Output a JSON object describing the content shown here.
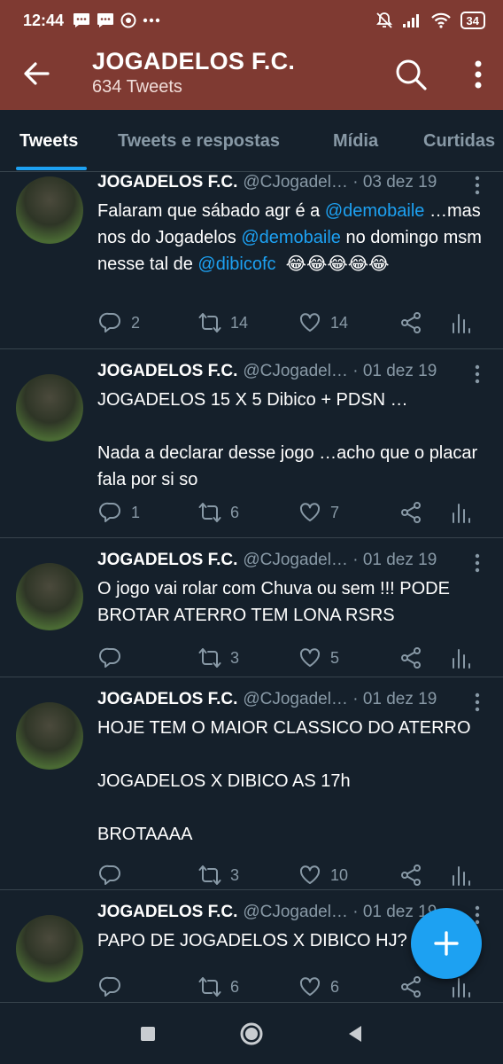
{
  "status_bar": {
    "time": "12:44",
    "battery": "34"
  },
  "header": {
    "title": "JOGADELOS F.C.",
    "subtitle": "634 Tweets"
  },
  "tabs": [
    {
      "label": "Tweets",
      "active": true
    },
    {
      "label": "Tweets e respostas",
      "active": false
    },
    {
      "label": "Mídia",
      "active": false
    },
    {
      "label": "Curtidas",
      "active": false
    }
  ],
  "tweets": [
    {
      "name": "JOGADELOS F.C.",
      "handle": "@CJogadel…",
      "date": " · 03 dez 19",
      "text": [
        {
          "t": "Falaram que sábado agr é a "
        },
        {
          "t": "@demobaile",
          "mention": true
        },
        {
          "t": " …mas nos do Jogadelos "
        },
        {
          "t": "@demobaile",
          "mention": true
        },
        {
          "t": " no domingo msm nesse tal de "
        },
        {
          "t": "@dibicofc",
          "mention": true
        },
        {
          "t": "  😂😂😂😂😂"
        }
      ],
      "replies": "2",
      "retweets": "14",
      "likes": "14"
    },
    {
      "name": "JOGADELOS F.C.",
      "handle": "@CJogadel…",
      "date": " · 01 dez 19",
      "text": [
        {
          "t": "JOGADELOS 15 X 5 Dibico + PDSN …\n\nNada a declarar desse jogo …acho que o placar fala por si so"
        }
      ],
      "replies": "1",
      "retweets": "6",
      "likes": "7"
    },
    {
      "name": "JOGADELOS F.C.",
      "handle": "@CJogadel…",
      "date": " · 01 dez 19",
      "text": [
        {
          "t": "O jogo vai rolar com Chuva ou sem !!! PODE BROTAR ATERRO TEM LONA RSRS"
        }
      ],
      "replies": "",
      "retweets": "3",
      "likes": "5"
    },
    {
      "name": "JOGADELOS F.C.",
      "handle": "@CJogadel…",
      "date": " · 01 dez 19",
      "text": [
        {
          "t": "HOJE TEM O MAIOR CLASSICO DO ATERRO\n\nJOGADELOS X DIBICO AS 17h\n\nBROTAAAA"
        }
      ],
      "replies": "",
      "retweets": "3",
      "likes": "10"
    },
    {
      "name": "JOGADELOS F.C.",
      "handle": "@CJogadel…",
      "date": " · 01 dez 19",
      "text": [
        {
          "t": "PAPO DE JOGADELOS X DIBICO HJ?"
        }
      ],
      "replies": "",
      "retweets": "6",
      "likes": "6"
    }
  ],
  "colors": {
    "header_bg": "#7f3a32",
    "background": "#15202b",
    "accent": "#1da1f2",
    "muted": "#8899a6"
  }
}
